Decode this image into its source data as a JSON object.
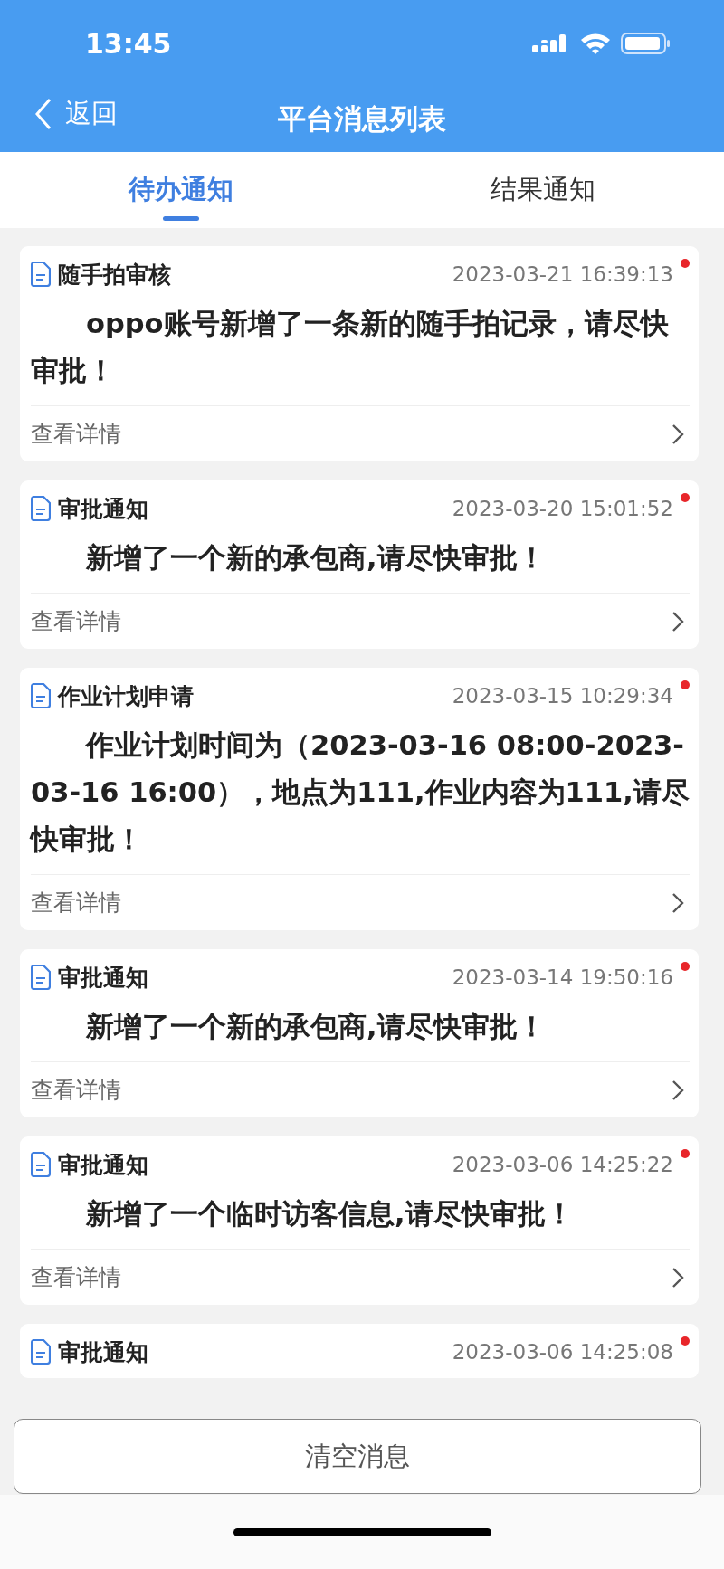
{
  "status_bar": {
    "time": "13:45"
  },
  "nav": {
    "back_label": "返回",
    "title": "平台消息列表"
  },
  "tabs": [
    {
      "label": "待办通知",
      "selected": true
    },
    {
      "label": "结果通知",
      "selected": false
    }
  ],
  "messages": [
    {
      "title": "随手拍审核",
      "time": "2023-03-21 16:39:13",
      "unread": true,
      "body": "oppo账号新增了一条新的随手拍记录，请尽快审批！",
      "link": "查看详情"
    },
    {
      "title": "审批通知",
      "time": "2023-03-20 15:01:52",
      "unread": true,
      "body": "新增了一个新的承包商,请尽快审批！",
      "link": "查看详情"
    },
    {
      "title": "作业计划申请",
      "time": "2023-03-15 10:29:34",
      "unread": true,
      "body": "作业计划时间为（2023-03-16 08:00-2023-03-16 16:00），地点为111,作业内容为111,请尽快审批！",
      "link": "查看详情"
    },
    {
      "title": "审批通知",
      "time": "2023-03-14 19:50:16",
      "unread": true,
      "body": "新增了一个新的承包商,请尽快审批！",
      "link": "查看详情"
    },
    {
      "title": "审批通知",
      "time": "2023-03-06 14:25:22",
      "unread": true,
      "body": "新增了一个临时访客信息,请尽快审批！",
      "link": "查看详情"
    },
    {
      "title": "审批通知",
      "time": "2023-03-06 14:25:08",
      "unread": true
    }
  ],
  "clear_button": "清空消息"
}
